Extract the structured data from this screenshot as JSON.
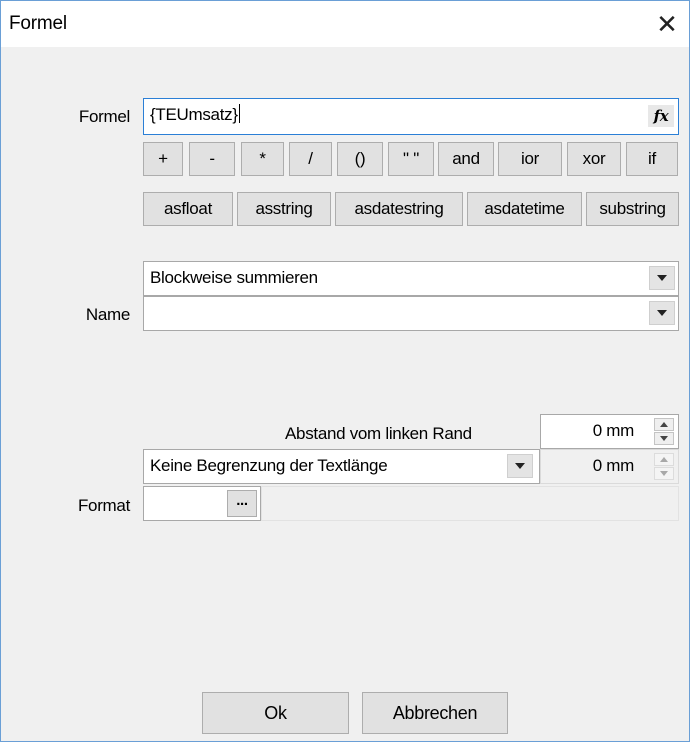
{
  "window": {
    "title": "Formel",
    "close_symbol": "✕"
  },
  "formula": {
    "label": "Formel",
    "value": "{TEUmsatz}",
    "fx_symbol": "fx",
    "operators": [
      "+",
      "-",
      "*",
      "/",
      "()",
      "\" \"",
      "and",
      "ior",
      "xor",
      "if"
    ],
    "functions": [
      "asfloat",
      "asstring",
      "asdatestring",
      "asdatetime",
      "substring"
    ]
  },
  "name": {
    "label": "Name",
    "aggregate_select": "Blockweise summieren",
    "name_select": ""
  },
  "format": {
    "margin_label": "Abstand vom linken Rand",
    "margin_value": "0 mm",
    "length_select": "Keine Begrenzung der Textlänge",
    "length_value": "0 mm",
    "label": "Format",
    "browse_label": "..."
  },
  "buttons": {
    "ok": "Ok",
    "cancel": "Abbrechen"
  }
}
